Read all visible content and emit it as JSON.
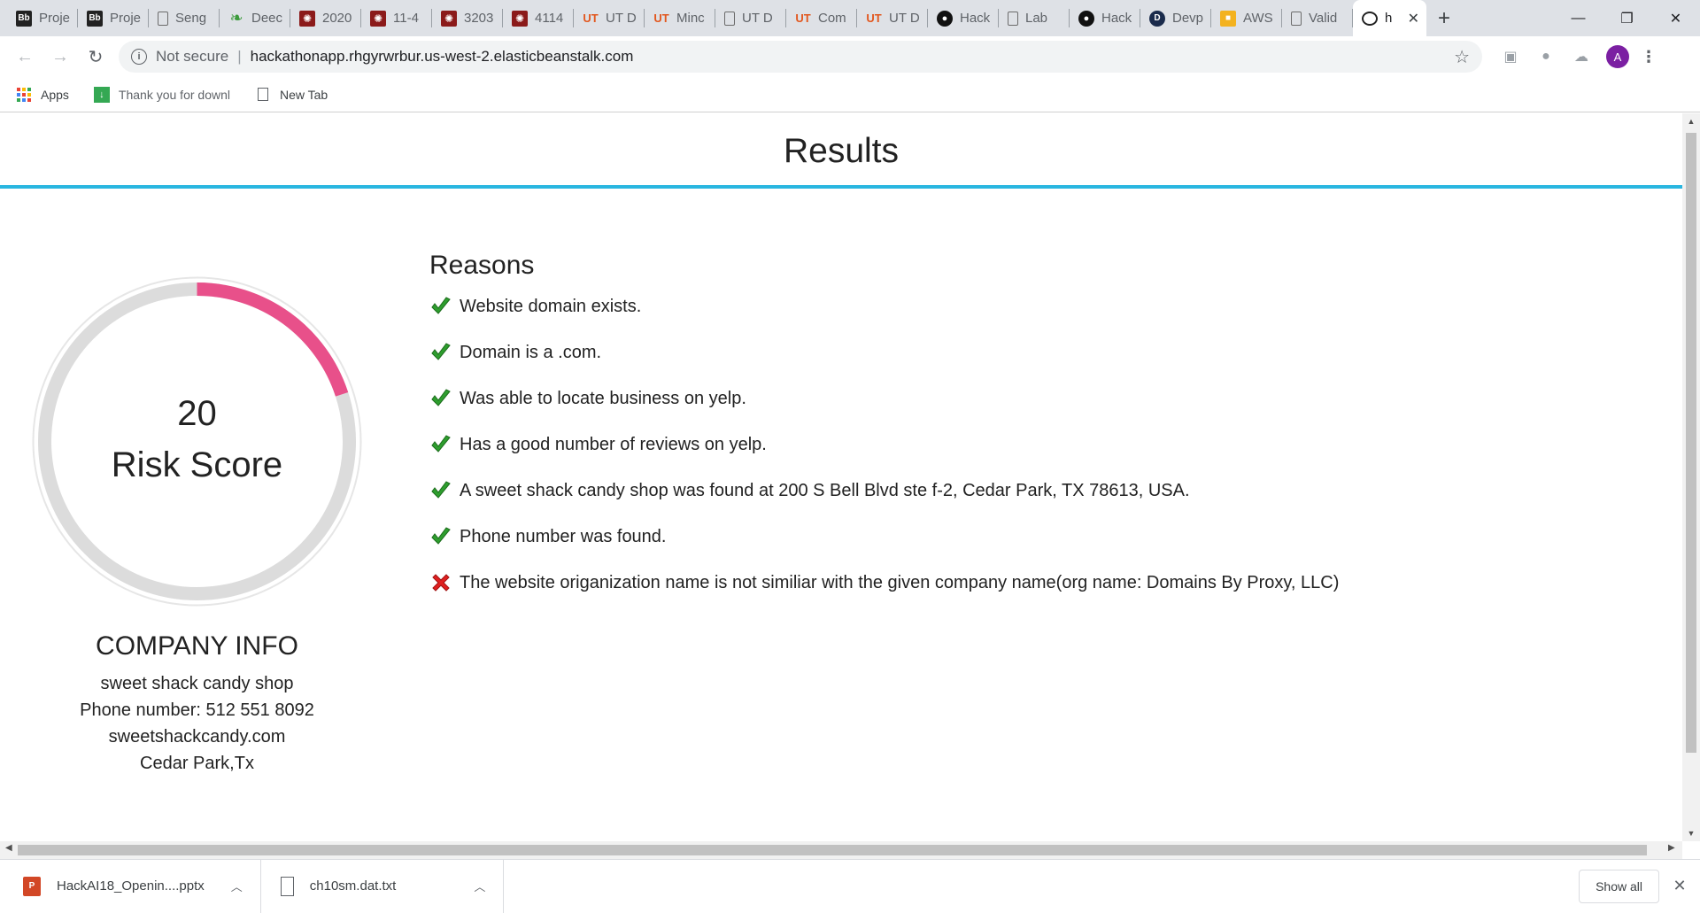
{
  "browser": {
    "tabs": [
      {
        "title": "Proje",
        "icon": "blackboard-icon"
      },
      {
        "title": "Proje",
        "icon": "blackboard-icon"
      },
      {
        "title": "Seng",
        "icon": "document-icon"
      },
      {
        "title": "Deec",
        "icon": "leaf-icon"
      },
      {
        "title": "2020",
        "icon": "symbolab-icon"
      },
      {
        "title": "11-4",
        "icon": "symbolab-icon"
      },
      {
        "title": "3203",
        "icon": "symbolab-icon"
      },
      {
        "title": "4114",
        "icon": "symbolab-icon"
      },
      {
        "title": "UT D",
        "icon": "ut-icon"
      },
      {
        "title": "Minc",
        "icon": "ut-icon"
      },
      {
        "title": "UT D",
        "icon": "document-icon"
      },
      {
        "title": "Com",
        "icon": "ut-icon"
      },
      {
        "title": "UT D",
        "icon": "ut-icon"
      },
      {
        "title": "Hack",
        "icon": "github-icon"
      },
      {
        "title": "Lab",
        "icon": "document-icon"
      },
      {
        "title": "Hack",
        "icon": "github-icon"
      },
      {
        "title": "Devp",
        "icon": "devpost-icon"
      },
      {
        "title": "AWS",
        "icon": "aws-icon"
      },
      {
        "title": "Valid",
        "icon": "document-icon"
      }
    ],
    "active_tab": {
      "title": "h",
      "icon": "codepen-icon",
      "close": "✕"
    },
    "new_tab": "+",
    "window_controls": {
      "minimize": "—",
      "restore": "❐",
      "close": "✕"
    },
    "address": {
      "security_label": "Not secure",
      "url": "hackathonapp.rhgyrwrbur.us-west-2.elasticbeanstalk.com"
    },
    "profile_initial": "A",
    "bookmarks": [
      {
        "label": "Apps",
        "icon": "apps-grid-icon"
      },
      {
        "label": "Thank you for downl",
        "icon": "download-page-icon"
      },
      {
        "label": "New Tab",
        "icon": "document-icon"
      }
    ]
  },
  "page": {
    "title": "Results",
    "risk": {
      "score": "20",
      "label": "Risk Score",
      "value": 20,
      "max": 100,
      "arc_color": "#e8508a",
      "track_color": "#dcdcdc"
    },
    "company": {
      "heading": "COMPANY INFO",
      "name": "sweet shack candy shop",
      "phone": "Phone number: 512 551 8092",
      "website": "sweetshackcandy.com",
      "location": "Cedar Park,Tx"
    },
    "reasons": {
      "heading": "Reasons",
      "items": [
        {
          "text": "Website domain exists.",
          "status": "pass"
        },
        {
          "text": "Domain is a .com.",
          "status": "pass"
        },
        {
          "text": "Was able to locate business on yelp.",
          "status": "pass"
        },
        {
          "text": "Has a good number of reviews on yelp.",
          "status": "pass"
        },
        {
          "text": "A sweet shack candy shop was found at 200 S Bell Blvd ste f-2, Cedar Park, TX 78613, USA.",
          "status": "pass"
        },
        {
          "text": "Phone number was found.",
          "status": "pass"
        },
        {
          "text": "The website origanization name is not similiar with the given company name(org name: Domains By Proxy, LLC)",
          "status": "fail"
        }
      ]
    },
    "accent_color": "#29b6e0"
  },
  "downloads": {
    "items": [
      {
        "name": "HackAI18_Openin....pptx",
        "icon": "powerpoint-icon"
      },
      {
        "name": "ch10sm.dat.txt",
        "icon": "text-file-icon"
      }
    ],
    "show_all": "Show all"
  }
}
